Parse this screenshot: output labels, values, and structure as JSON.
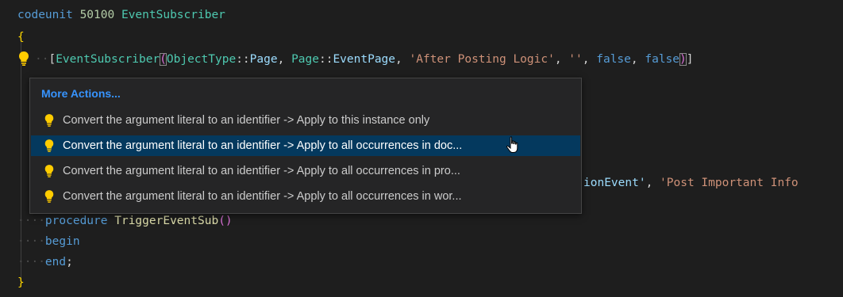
{
  "code": {
    "line1": {
      "keyword": "codeunit",
      "number": "50100",
      "name": "EventSubscriber"
    },
    "line2": {
      "open_brace": "{"
    },
    "line3": {
      "open_bracket": "[",
      "attribute": "EventSubscriber",
      "open_paren": "(",
      "object_type": "ObjectType",
      "sep1": "::",
      "page1": "Page",
      "comma1": ", ",
      "page2": "Page",
      "sep2": "::",
      "event_page": "EventPage",
      "comma2": ", ",
      "string1": "'After Posting Logic'",
      "comma3": ", ",
      "string2": "''",
      "comma4": ", ",
      "false1": "false",
      "comma5": ", ",
      "false2": "false",
      "close_paren": ")",
      "close_bracket": "]"
    },
    "line_partial": {
      "ident": "ionEvent'",
      "comma": ", ",
      "string": "'Post Important Info"
    },
    "line_procedure": {
      "keyword": "procedure",
      "name": "TriggerEventSub",
      "parens": "()"
    },
    "line_begin": {
      "keyword": "begin"
    },
    "line_end": {
      "keyword": "end",
      "semicolon": ";"
    },
    "line_close": {
      "close_brace": "}"
    }
  },
  "popup": {
    "header": "More Actions...",
    "items": [
      {
        "label": "Convert the argument literal to an identifier -> Apply to this instance only",
        "selected": false
      },
      {
        "label": "Convert the argument literal to an identifier -> Apply to all occurrences in doc...",
        "selected": true
      },
      {
        "label": "Convert the argument literal to an identifier -> Apply to all occurrences in pro...",
        "selected": false
      },
      {
        "label": "Convert the argument literal to an identifier -> Apply to all occurrences in wor...",
        "selected": false
      }
    ]
  },
  "icons": {
    "gutter": "lightbulb-icon",
    "item": "lightbulb-icon",
    "cursor": "hand-pointer-icon"
  },
  "colors": {
    "background": "#1e1e1e",
    "popup_background": "#252526",
    "selection": "#04395e",
    "header_link": "#3794ff",
    "lightbulb": "#ffcc00"
  }
}
